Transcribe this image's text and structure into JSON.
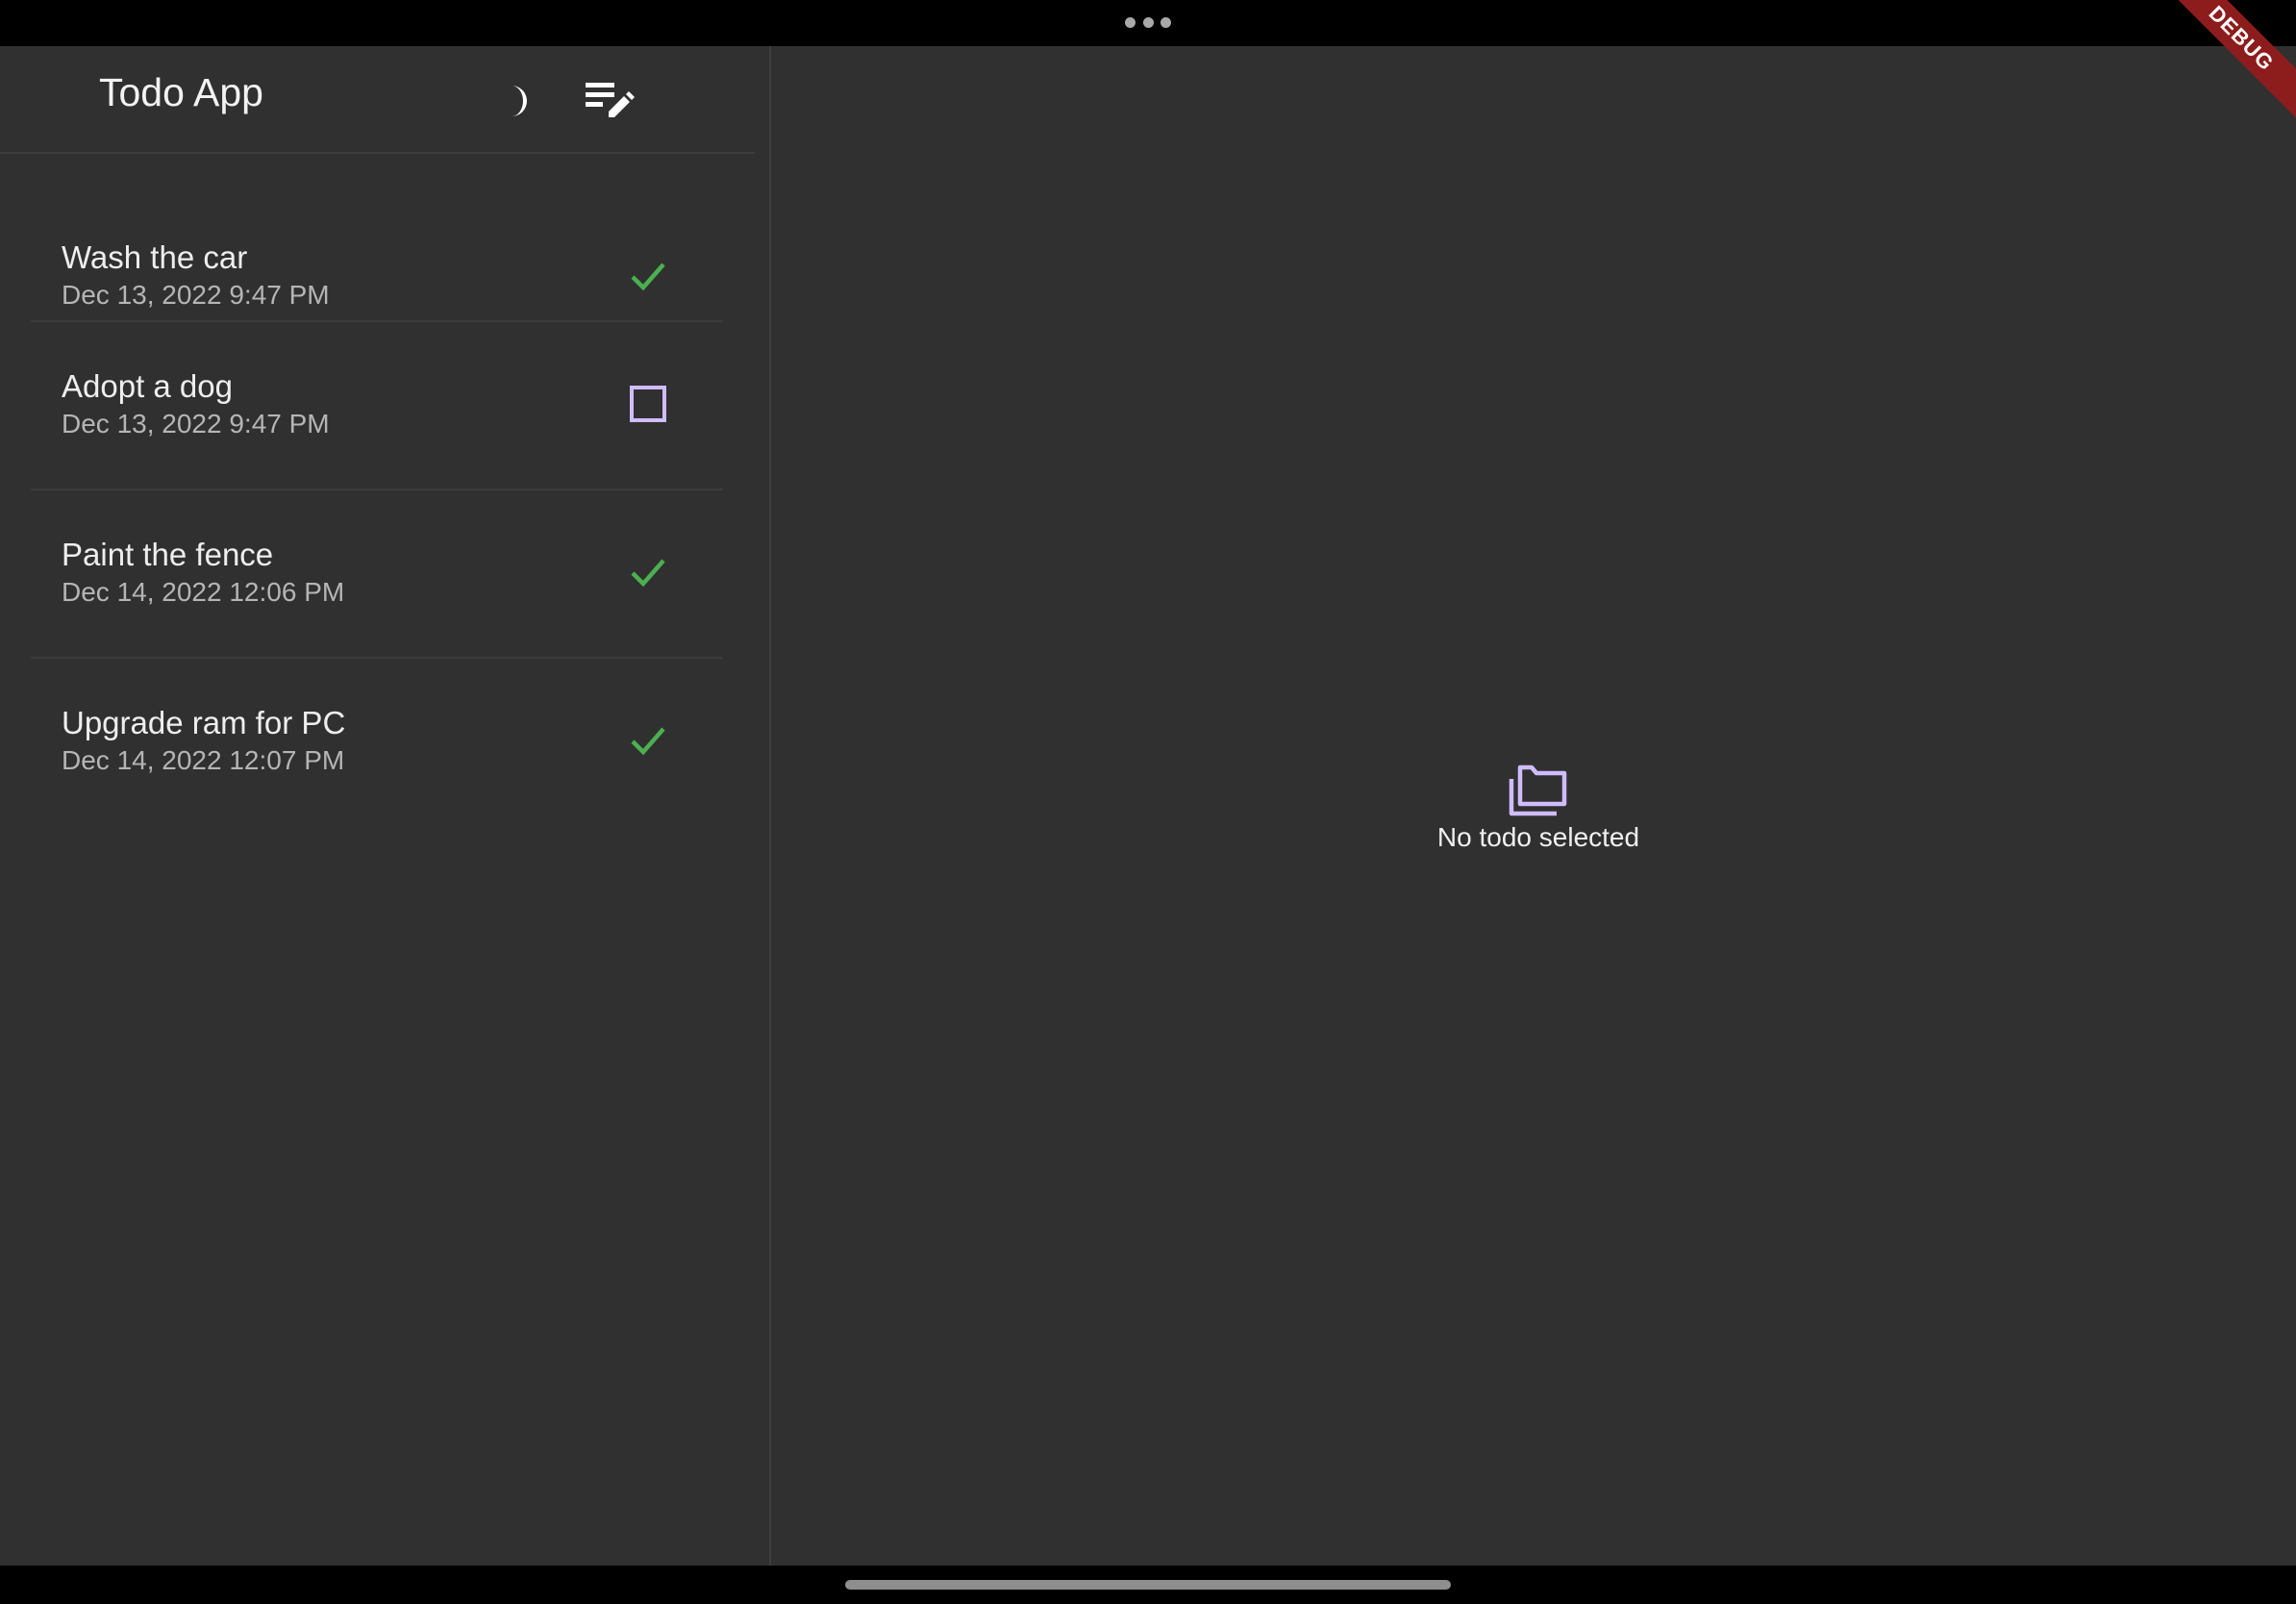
{
  "header": {
    "title": "Todo App",
    "theme_icon": "moon-icon",
    "edit_icon": "playlist-edit-icon"
  },
  "todos": [
    {
      "title": "Wash the car",
      "date": "Dec 13, 2022  9:47 PM",
      "completed": true
    },
    {
      "title": "Adopt a dog",
      "date": "Dec 13, 2022  9:47 PM",
      "completed": false
    },
    {
      "title": "Paint the fence",
      "date": "Dec 14, 2022  12:06 PM",
      "completed": true
    },
    {
      "title": "Upgrade ram for PC",
      "date": "Dec 14, 2022  12:07 PM",
      "completed": true
    }
  ],
  "detail": {
    "empty_icon": "folders-icon",
    "empty_text": "No todo selected"
  },
  "debug_banner": "DEBUG",
  "colors": {
    "background": "#303030",
    "accent": "#d0bcff",
    "success": "#4caf50",
    "debug": "#8d1c1c"
  }
}
